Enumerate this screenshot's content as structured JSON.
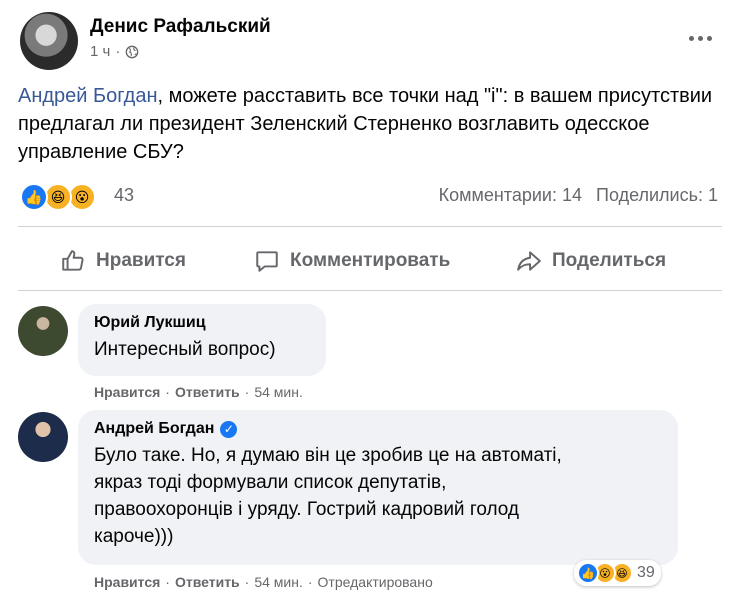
{
  "post": {
    "author": "Денис Рафальский",
    "time": "1 ч",
    "separator": "·",
    "mention": "Андрей Богдан",
    "text": ", можете расставить все точки над \"і\": в вашем присутствии предлагал ли президент Зеленский Стерненко возглавить одесское управление СБУ?",
    "reactions_count": "43",
    "comments_stat": "Комментарии: 14",
    "shares_stat": "Поделились: 1"
  },
  "actions": {
    "like": "Нравится",
    "comment": "Комментировать",
    "share": "Поделиться"
  },
  "comments": [
    {
      "author": "Юрий Лукшиц",
      "text": "Интересный вопрос)",
      "like": "Нравится",
      "reply": "Ответить",
      "time": "54 мин.",
      "sep": "·"
    },
    {
      "author": "Андрей Богдан",
      "verified": true,
      "text_lines": [
        "Було таке. Но, я думаю він це зробив це на автоматі,",
        "якраз тоді формували список депутатів,",
        "правоохоронців і уряду. Гострий кадровий голод",
        "кароче)))"
      ],
      "like": "Нравится",
      "reply": "Ответить",
      "time": "54 мин.",
      "edited": "Отредактировано",
      "sep": "·",
      "reactions_count": "39"
    }
  ],
  "icons": [
    "globe-icon",
    "more-icon",
    "like-icon",
    "comment-icon",
    "share-icon",
    "verified-icon",
    "like-reaction-icon",
    "haha-reaction-icon",
    "wow-reaction-icon"
  ],
  "colors": {
    "link": "#385898",
    "secondary": "#65676b",
    "bubble": "#f0f2f5",
    "accent": "#1877f2",
    "reaction_yellow": "#f7b125"
  }
}
